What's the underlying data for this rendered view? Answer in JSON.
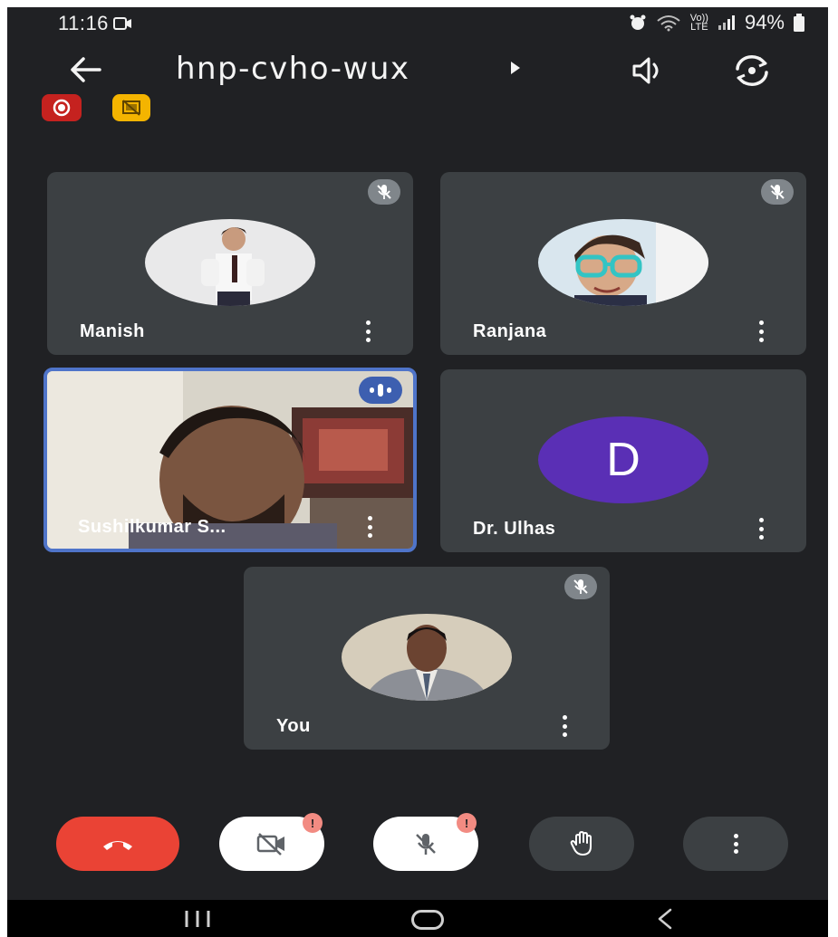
{
  "status_bar": {
    "time": "11:16",
    "icons": [
      "video-recording-icon",
      "alarm-icon",
      "wifi-icon",
      "volte-icon",
      "signal-icon",
      "battery-icon"
    ],
    "volte_line1": "Vo))",
    "volte_line2": "LTE",
    "battery": "94%"
  },
  "header": {
    "title": "hnp-cvho-wux",
    "icons": [
      "back-arrow-icon",
      "speaker-icon",
      "switch-camera-icon"
    ]
  },
  "badges": {
    "recording_color": "#c5221f",
    "presentation_color": "#f4b400"
  },
  "participants": [
    {
      "name": "Manish",
      "muted": true,
      "avatar": "photo"
    },
    {
      "name": "Ranjana",
      "muted": true,
      "avatar": "photo"
    },
    {
      "name": "Sushilkumar S...",
      "muted": false,
      "speaking": true,
      "video": true
    },
    {
      "name": "Dr. Ulhas",
      "muted": false,
      "avatar_letter": "D",
      "avatar_color": "#5a2fb5"
    },
    {
      "name": "You",
      "muted": true,
      "avatar": "photo"
    }
  ],
  "controls": {
    "end_call_color": "#ea4335",
    "camera_alert": "!",
    "mic_alert": "!",
    "icons": [
      "end-call-icon",
      "camera-off-icon",
      "mic-off-icon",
      "raise-hand-icon",
      "more-vert-icon"
    ]
  },
  "nav_bar": {
    "icons": [
      "recent-apps-icon",
      "home-icon",
      "back-icon"
    ]
  },
  "colors": {
    "background": "#202124",
    "tile": "#3c4043",
    "active_border": "#4f74c9"
  }
}
